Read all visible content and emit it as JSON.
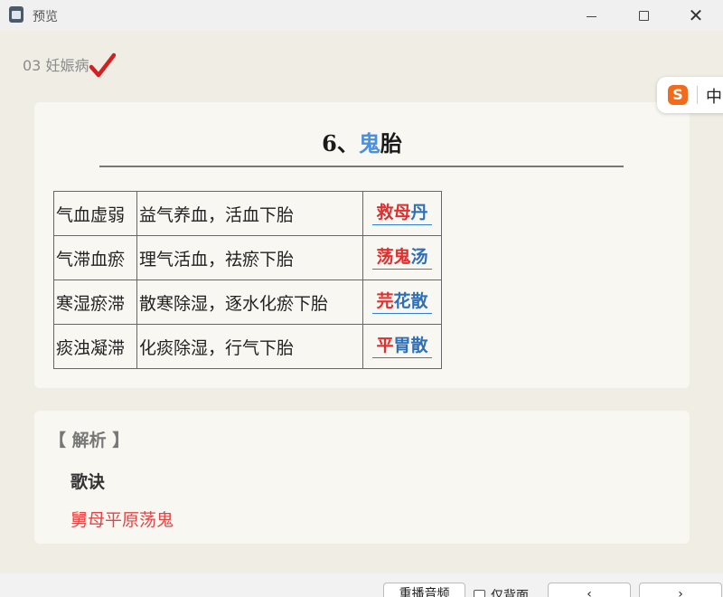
{
  "window": {
    "title": "预览",
    "minimize_glyph": "",
    "maximize_glyph": "",
    "close_glyph": "✕"
  },
  "chapter": {
    "label": "03 妊娠病"
  },
  "ime": {
    "logo": "S",
    "mode": "中"
  },
  "main": {
    "heading_prefix": "6、",
    "heading_highlight": "鬼",
    "heading_suffix": "胎",
    "rows": [
      {
        "pattern": "气血虚弱",
        "method": "益气养血，活血下胎",
        "rx_red": "救母",
        "rx_blue": "丹"
      },
      {
        "pattern": "气滞血瘀",
        "method": "理气活血，祛瘀下胎",
        "rx_red": "荡鬼",
        "rx_blue": "汤"
      },
      {
        "pattern": "寒湿瘀滞",
        "method": "散寒除湿，逐水化瘀下胎",
        "rx_red": "芫",
        "rx_blue": "花散"
      },
      {
        "pattern": "痰浊凝滞",
        "method": "化痰除湿，行气下胎",
        "rx_red": "平",
        "rx_blue": "胃散"
      }
    ]
  },
  "analysis": {
    "label": "【 解析 】",
    "rhyme_title": "歌诀",
    "rhyme_text": "舅母平原荡鬼"
  },
  "bottom": {
    "replay_label": "重播音频",
    "back_only_label": "仅背面",
    "prev_label": "‹",
    "next_label": "›"
  },
  "colors": {
    "heading_accent": "#4a8fe0",
    "rx_red": "#e12f2f",
    "rx_blue": "#2f6fb8",
    "rhyme": "#e24545",
    "check": "#d42020"
  },
  "icons": [
    "app-icon",
    "check-icon",
    "sogou-ime-icon"
  ]
}
